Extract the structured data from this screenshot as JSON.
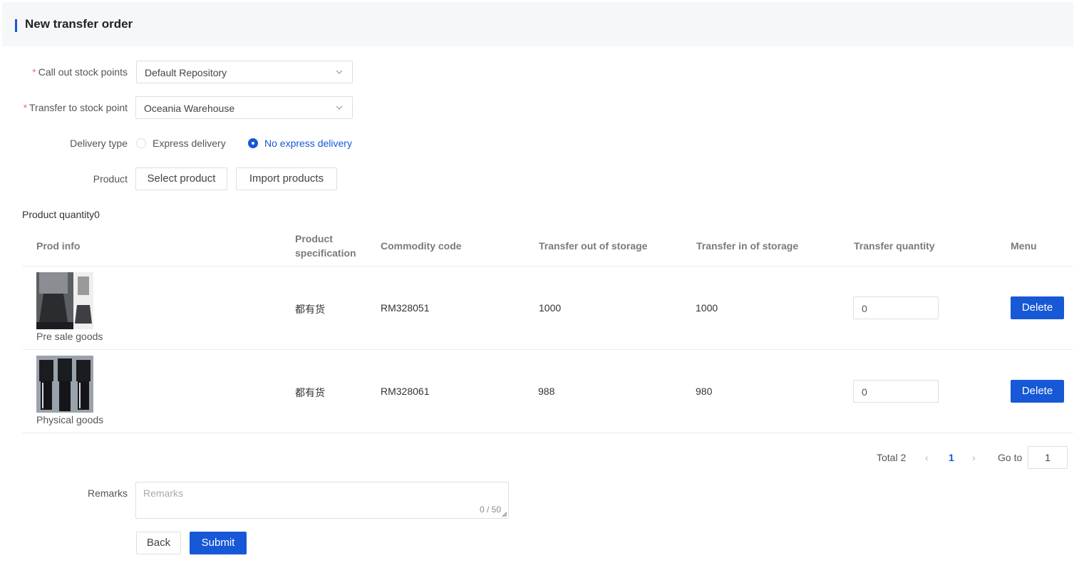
{
  "page": {
    "title": "New transfer order"
  },
  "form": {
    "required_mark": "*",
    "call_out_label": "Call out stock points",
    "call_out_value": "Default Repository",
    "transfer_to_label": "Transfer to stock point",
    "transfer_to_value": "Oceania Warehouse",
    "delivery_label": "Delivery type",
    "delivery_options": [
      {
        "label": "Express delivery",
        "checked": false
      },
      {
        "label": "No express delivery",
        "checked": true
      }
    ],
    "product_label": "Product",
    "select_product_label": "Select product",
    "import_products_label": "Import products",
    "product_quantity_text": "Product quantity0"
  },
  "table": {
    "headers": {
      "prod_info": "Prod info",
      "spec_line1": "Product",
      "spec_line2": "specification",
      "code": "Commodity code",
      "out": "Transfer out of storage",
      "in": "Transfer in of storage",
      "qty": "Transfer quantity",
      "menu": "Menu"
    },
    "rows": [
      {
        "name": "Pre sale goods",
        "spec": "都有货",
        "code": "RM328051",
        "out": "1000",
        "in": "1000",
        "qty": "0",
        "delete_label": "Delete"
      },
      {
        "name": "Physical goods",
        "spec": "都有货",
        "code": "RM328061",
        "out": "988",
        "in": "980",
        "qty": "0",
        "delete_label": "Delete"
      }
    ]
  },
  "pagination": {
    "total_text": "Total 2",
    "current_page": "1",
    "goto_label": "Go to",
    "goto_value": "1"
  },
  "remarks": {
    "label": "Remarks",
    "placeholder": "Remarks",
    "counter": "0 / 50"
  },
  "actions": {
    "back_label": "Back",
    "submit_label": "Submit"
  },
  "colors": {
    "primary": "#1658d6",
    "required": "#f56c6c",
    "header_bg": "#f6f7f9"
  }
}
